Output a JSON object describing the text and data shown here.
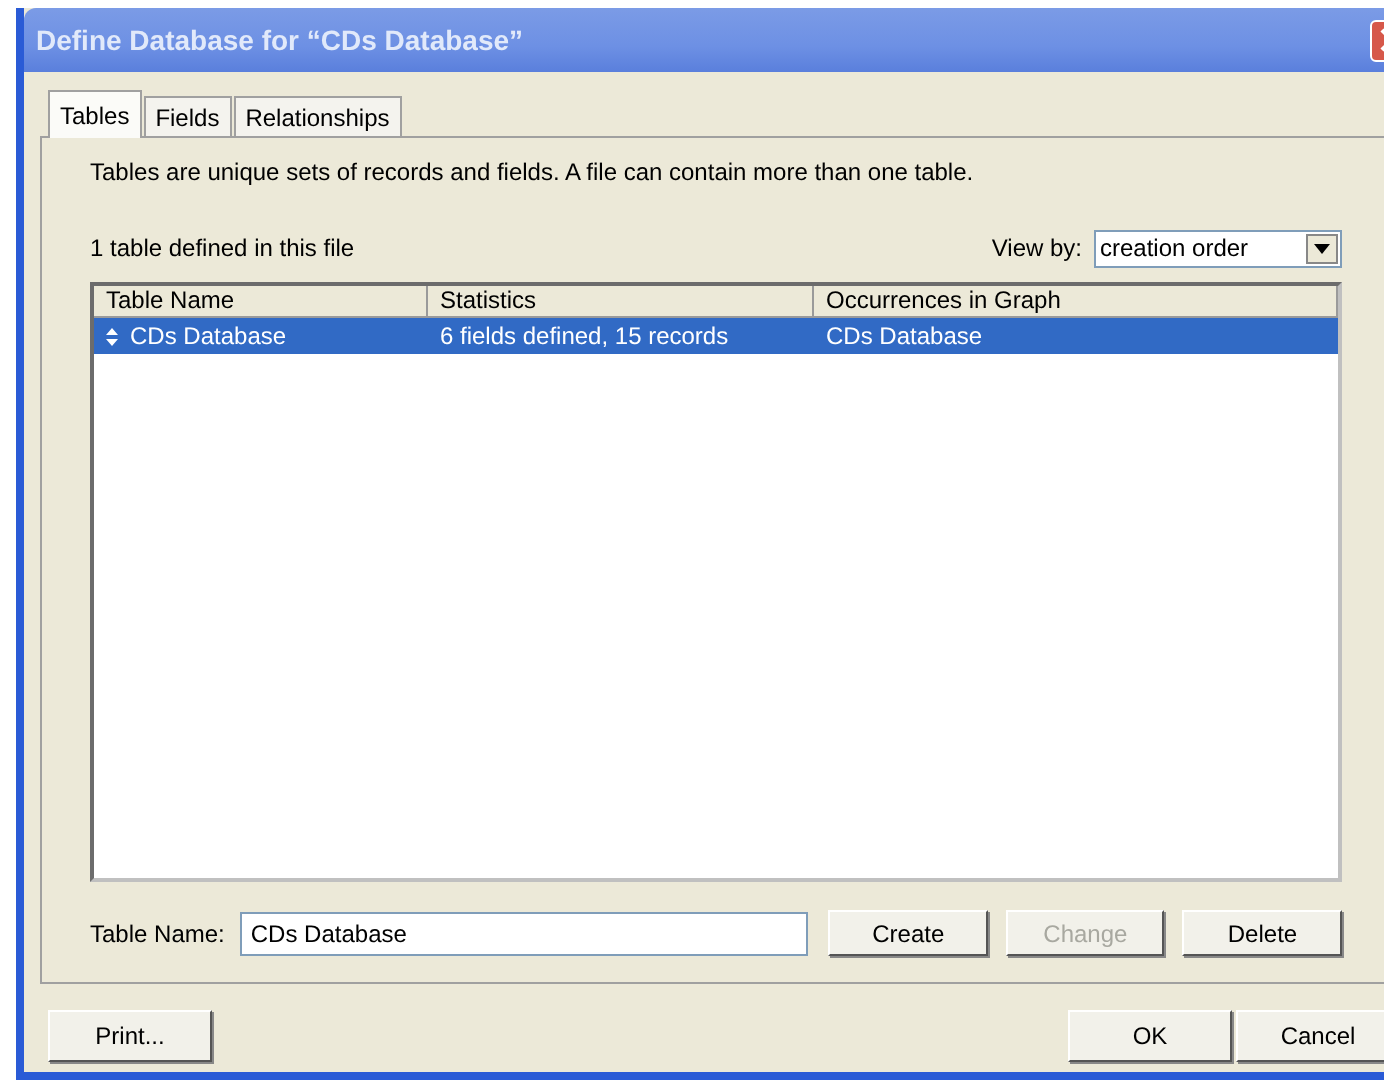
{
  "window": {
    "title": "Define Database for “CDs Database”"
  },
  "tabs": [
    {
      "label": "Tables",
      "selected": true
    },
    {
      "label": "Fields",
      "selected": false
    },
    {
      "label": "Relationships",
      "selected": false
    }
  ],
  "description": "Tables are unique sets of records and fields. A file can contain more than one table.",
  "count_label": "1 table defined in this file",
  "view_by": {
    "label": "View by:",
    "value": "creation order"
  },
  "table": {
    "columns": [
      "Table Name",
      "Statistics",
      "Occurrences in Graph"
    ],
    "rows": [
      {
        "cells": [
          "CDs Database",
          "6 fields defined, 15 records",
          "CDs Database"
        ],
        "selected": true
      }
    ]
  },
  "table_name": {
    "label": "Table Name:",
    "value": "CDs Database"
  },
  "actions": [
    {
      "label": "Create",
      "disabled": false
    },
    {
      "label": "Change",
      "disabled": true
    },
    {
      "label": "Delete",
      "disabled": false
    }
  ],
  "footer": {
    "print": "Print...",
    "ok": "OK",
    "cancel": "Cancel"
  }
}
